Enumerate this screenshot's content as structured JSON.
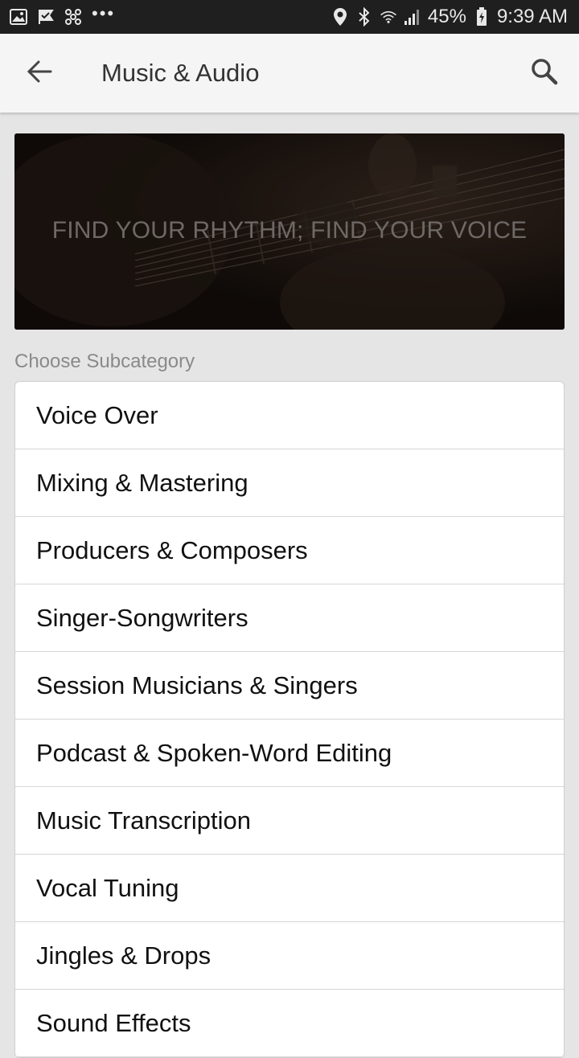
{
  "status_bar": {
    "battery": "45%",
    "time": "9:39 AM",
    "dots": "•••",
    "icons": [
      "image-icon",
      "flag-icon",
      "fan-icon",
      "location-icon",
      "bluetooth-icon",
      "wifi-icon",
      "signal-icon",
      "battery-icon"
    ]
  },
  "app_bar": {
    "title": "Music & Audio",
    "back_icon": "arrow-left-icon",
    "search_icon": "search-icon"
  },
  "banner": {
    "text": "FIND YOUR RHYTHM; FIND YOUR VOICE"
  },
  "subcategory": {
    "label": "Choose Subcategory",
    "items": [
      {
        "label": "Voice Over"
      },
      {
        "label": "Mixing & Mastering"
      },
      {
        "label": "Producers & Composers"
      },
      {
        "label": "Singer-Songwriters"
      },
      {
        "label": "Session Musicians & Singers"
      },
      {
        "label": "Podcast & Spoken-Word Editing"
      },
      {
        "label": "Music Transcription"
      },
      {
        "label": "Vocal Tuning"
      },
      {
        "label": "Jingles & Drops"
      },
      {
        "label": "Sound Effects"
      }
    ]
  }
}
